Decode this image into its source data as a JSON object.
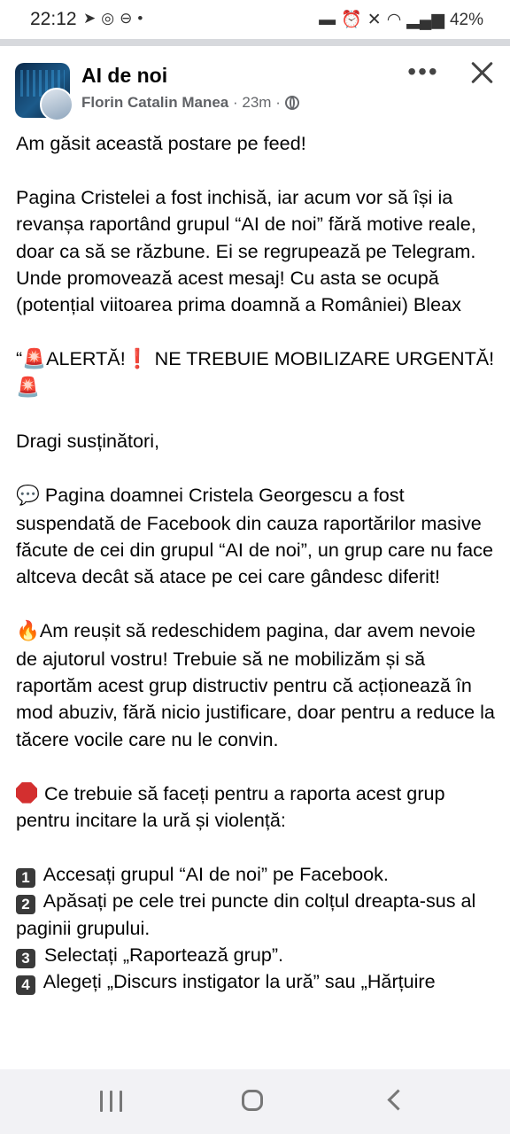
{
  "status_bar": {
    "time": "22:12",
    "left_icons": [
      "telegram-icon",
      "whatsapp-icon",
      "do-not-disturb-icon",
      "dot-icon"
    ],
    "right_icons": [
      "bed-icon",
      "alarm-icon",
      "mute-icon",
      "wifi-icon",
      "volte-icon",
      "signal-icon"
    ],
    "battery": "42%"
  },
  "post": {
    "group_name": "AI de noi",
    "author": "Florin Catalin Manea",
    "time": "23m",
    "separator": "·",
    "privacy_icon": "globe-icon",
    "more_label": "•••",
    "paragraphs": {
      "p1": "Am găsit această postare pe feed!",
      "p2": "Pagina Cristelei a fost inchisă, iar acum vor să își ia revanșa raportând grupul “AI de noi” fără motive reale, doar ca să se răzbune. Ei se regrupează pe Telegram. Unde promovează acest mesaj! Cu asta se ocupă (potențial viitoarea prima doamnă a României) Bleax",
      "p3_quote": "“",
      "p3_siren": "🚨",
      "p3_a": "ALERTĂ!",
      "p3_excl": "❗",
      "p3_b": " NE TREBUIE MOBILIZARE URGENTĂ! ",
      "p3_siren2": "🚨",
      "p4": "Dragi susținători,",
      "p5_icon": "💬",
      "p5": " Pagina doamnei Cristela Georgescu a fost suspendată de Facebook din cauza raportărilor masive făcute de cei din grupul “AI de noi”, un grup care nu face altceva decât să atace pe cei care gândesc diferit!",
      "p6_icon": "🔥",
      "p6": "Am reușit să redeschidem pagina, dar avem nevoie de ajutorul vostru! Trebuie să ne mobilizăm și să raportăm acest grup distructiv pentru că acționează în mod abuziv, fără nicio justificare, doar pentru a reduce la tăcere vocile care nu le convin.",
      "p7": " Ce trebuie să faceți pentru a raporta acest grup pentru incitare la ură și violență:",
      "steps": [
        {
          "num": "1",
          "text": " Accesați grupul “AI de noi” pe Facebook."
        },
        {
          "num": "2",
          "text": " Apăsați pe cele trei puncte din colțul dreapta-sus al paginii grupului."
        },
        {
          "num": "3",
          "text": " Selectați „Raportează grup”."
        },
        {
          "num": "4",
          "text": " Alegeți „Discurs instigator la ură” sau „Hărțuire"
        }
      ]
    }
  },
  "nav_bar": {
    "icons": [
      "recent-apps-icon",
      "home-icon",
      "back-icon"
    ]
  }
}
